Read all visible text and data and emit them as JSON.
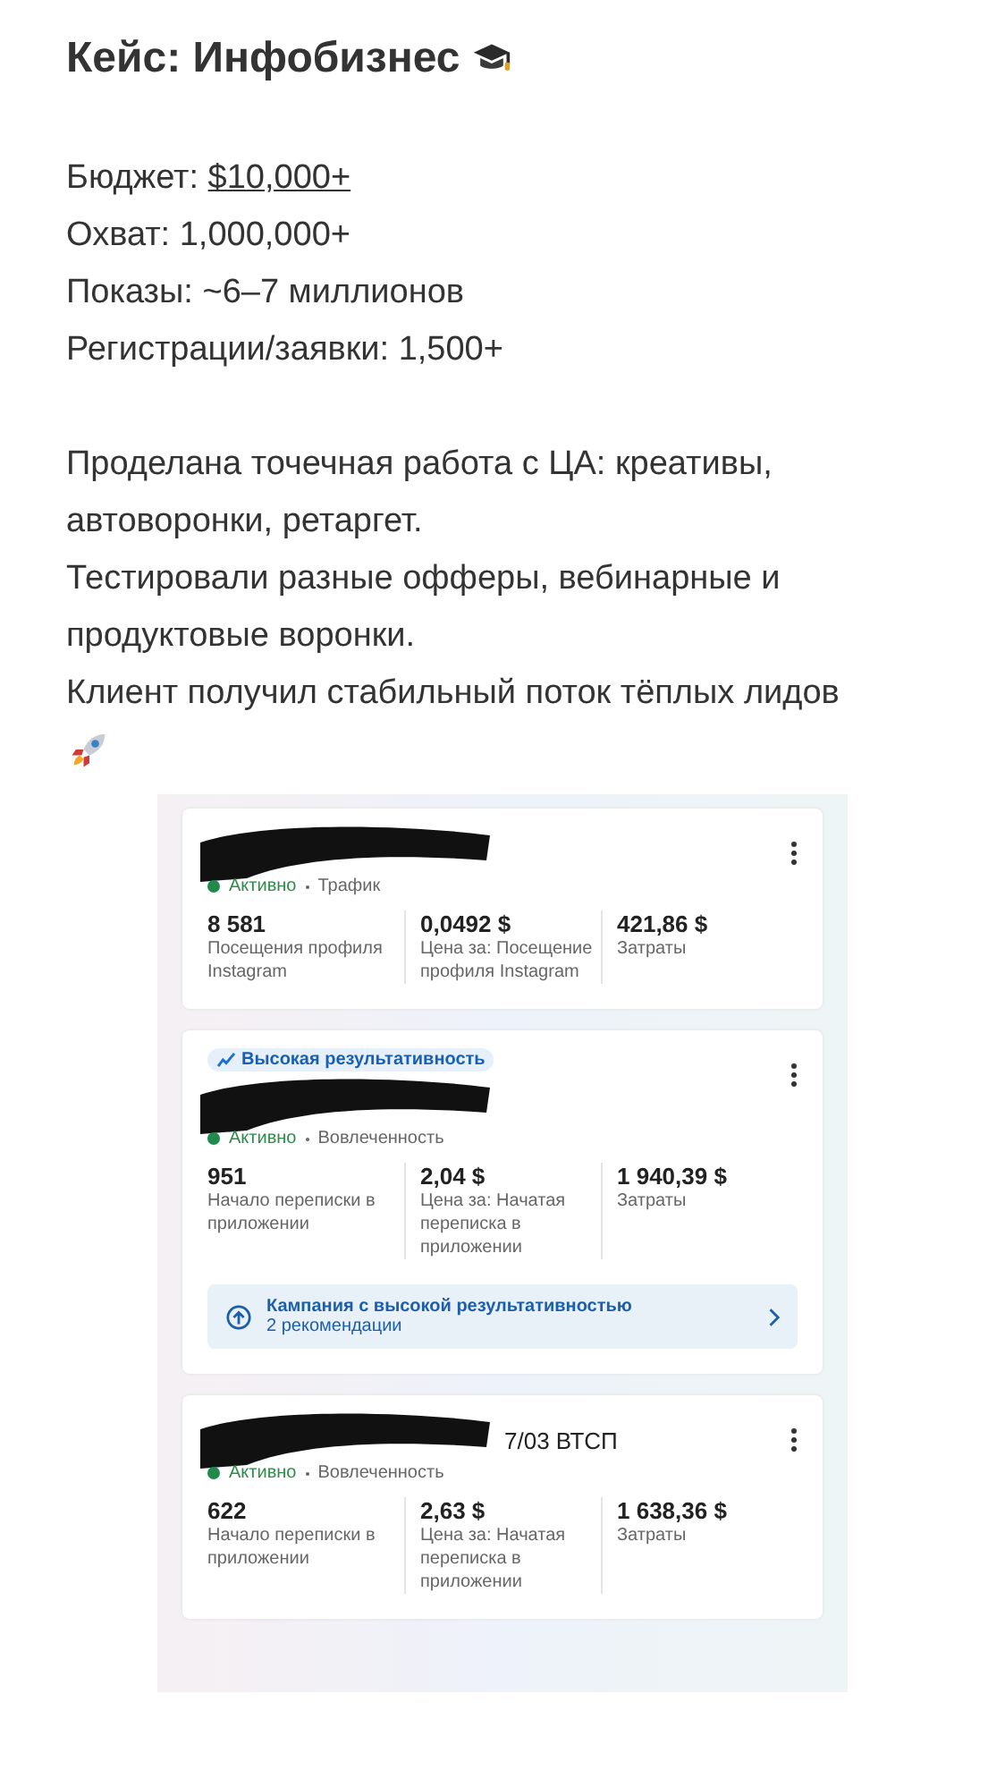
{
  "title": "Кейс: Инфобизнес",
  "stats": [
    {
      "label": "Бюджет: ",
      "value": "$10,000+",
      "kind": "link"
    },
    {
      "label": "Охват: ",
      "value": "1,000,000+",
      "kind": "plain"
    },
    {
      "label": "Показы: ",
      "value": "~6–7 миллионов",
      "kind": "plain"
    },
    {
      "label": "Регистрации/заявки: ",
      "value": "1,500+",
      "kind": "plain"
    }
  ],
  "paragraph": [
    "Проделана точечная работа с ЦА: креативы, автоворонки, ретаргет.",
    "Тестировали разные офферы, вебинарные и продуктовые воронки.",
    "Клиент получил стабильный поток тёплых лидов"
  ],
  "campaigns": [
    {
      "status": "Активно",
      "goal": "Трафик",
      "metrics": [
        {
          "value": "8 581",
          "label": "Посещения профиля Instagram"
        },
        {
          "value": "0,0492 $",
          "label": "Цена за: Посещение профиля Instagram"
        },
        {
          "value": "421,86 $",
          "label": "Затраты"
        }
      ]
    },
    {
      "badge": "Высокая результативность",
      "status": "Активно",
      "goal": "Вовлеченность",
      "metrics": [
        {
          "value": "951",
          "label": "Начало переписки в приложении"
        },
        {
          "value": "2,04 $",
          "label": "Цена за: Начатая переписка в приложении"
        },
        {
          "value": "1 940,39 $",
          "label": "Затраты"
        }
      ],
      "recommendation": {
        "title": "Кампания с высокой результативностью",
        "subtitle": "2 рекомендации"
      }
    },
    {
      "name": "7/03 ВТСП",
      "status": "Активно",
      "goal": "Вовлеченность",
      "metrics": [
        {
          "value": "622",
          "label": "Начало переписки в приложении"
        },
        {
          "value": "2,63 $",
          "label": "Цена за: Начатая переписка в приложении"
        },
        {
          "value": "1 638,36 $",
          "label": "Затраты"
        }
      ]
    }
  ]
}
